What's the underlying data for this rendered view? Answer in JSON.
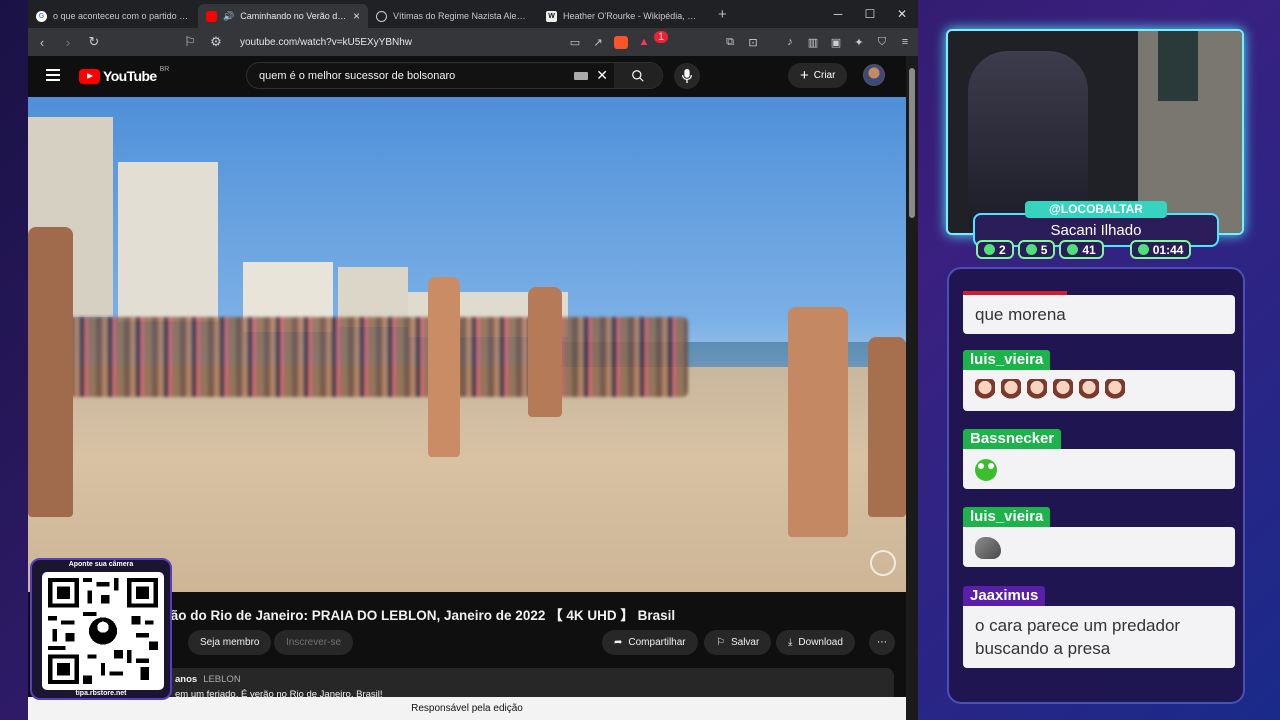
{
  "browser": {
    "tabs": [
      {
        "title": "o que aconteceu com o partido PRONA - Pe",
        "icon": "google-icon",
        "active": false
      },
      {
        "title": "Caminhando no Verão do Rio de",
        "icon": "youtube-icon",
        "active": true
      },
      {
        "title": "Vítimas do Regime Nazista Alemão - Grok",
        "icon": "grok-icon",
        "active": false
      },
      {
        "title": "Heather O'Rourke - Wikipédia, a enciclopé",
        "icon": "wikipedia-icon",
        "active": false
      }
    ],
    "url": "youtube.com/watch?v=kU5EXyYBNhw",
    "brave_badge": "1"
  },
  "youtube": {
    "logo_text": "YouTube",
    "region": "BR",
    "search_query": "quem é o melhor sucessor de bolsonaro",
    "create_label": "Criar",
    "video_title": "erão do Rio de Janeiro: PRAIA DO LEBLON, Janeiro de 2022 【 4K UHD 】 Brasil",
    "join_label": "Seja membro",
    "subscribe_label": "Inscrever-se",
    "share_label": "Compartilhar",
    "save_label": "Salvar",
    "download_label": "Download",
    "desc_age": "anos",
    "desc_tag": "LEBLON",
    "desc_text": "em um feriado. É verão no Rio de Janeiro, Brasil!",
    "bottom_notice": "Responsável pela edição"
  },
  "qr": {
    "caption": "Aponte sua câmera",
    "footer": "tipa.rbstore.net"
  },
  "stream": {
    "handle": "@LOCOBALTAR",
    "name": "Sacani Ilhado",
    "stats": [
      {
        "icon": "chat-icon",
        "value": "2"
      },
      {
        "icon": "youtube-icon",
        "value": "5"
      },
      {
        "icon": "viewers-icon",
        "value": "41"
      },
      {
        "icon": "clock-icon",
        "value": "01:44"
      }
    ]
  },
  "chat": [
    {
      "user": "",
      "text": "que morena",
      "color": "#d01f2c"
    },
    {
      "user": "luis_vieira",
      "text": "",
      "emote": "anime-girl-emote",
      "emote_count": 6,
      "color": "#1bb34a"
    },
    {
      "user": "Bassnecker",
      "text": "",
      "emote": "frog-emote",
      "color": "#1bb34a"
    },
    {
      "user": "luis_vieira",
      "text": "",
      "emote": "seal-emote",
      "color": "#1bb34a"
    },
    {
      "user": "Jaaximus",
      "text": "o cara parece um predador buscando a presa",
      "color": "#5a1fa8"
    }
  ]
}
